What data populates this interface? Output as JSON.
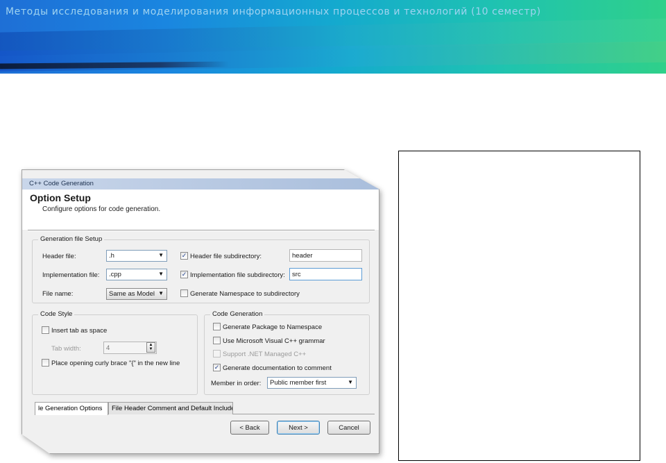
{
  "banner": {
    "title": "Методы исследования и моделирования информационных процессов и технологий (10 семестр)"
  },
  "dialog": {
    "caption": "C++ Code Generation",
    "title": "Option Setup",
    "subtitle": "Configure options for code generation.",
    "generation_setup": {
      "legend": "Generation file Setup",
      "header_file_label": "Header file:",
      "header_file_value": ".h",
      "implementation_file_label": "Implementation file:",
      "implementation_file_value": ".cpp",
      "file_name_label": "File name:",
      "file_name_value": "Same as Model",
      "header_subdir_label": "Header file subdirectory:",
      "header_subdir_checked": true,
      "header_subdir_value": "header",
      "impl_subdir_label": "Implementation file subdirectory:",
      "impl_subdir_checked": true,
      "impl_subdir_value": "src",
      "namespace_subdir_label": "Generate Namespace to subdirectory",
      "namespace_subdir_checked": false
    },
    "code_style": {
      "legend": "Code Style",
      "insert_tab_label": "Insert tab as space",
      "insert_tab_checked": false,
      "tab_width_label": "Tab width:",
      "tab_width_value": "4",
      "curly_brace_label": "Place opening curly brace \"{\" in the new line",
      "curly_brace_checked": false
    },
    "code_generation": {
      "legend": "Code Generation",
      "package_ns_label": "Generate Package to Namespace",
      "package_ns_checked": false,
      "msvc_label": "Use Microsoft Visual C++ grammar",
      "msvc_checked": false,
      "dotnet_label": "Support .NET Managed C++",
      "dotnet_checked": false,
      "doc_comment_label": "Generate documentation to comment",
      "doc_comment_checked": true,
      "member_order_label": "Member in order:",
      "member_order_value": "Public member first"
    },
    "tabs": [
      {
        "label": "le Generation Options",
        "active": true
      },
      {
        "label": "File Header Comment and Default Include",
        "active": false
      }
    ],
    "buttons": {
      "back": "< Back",
      "next": "Next >",
      "cancel": "Cancel"
    }
  }
}
